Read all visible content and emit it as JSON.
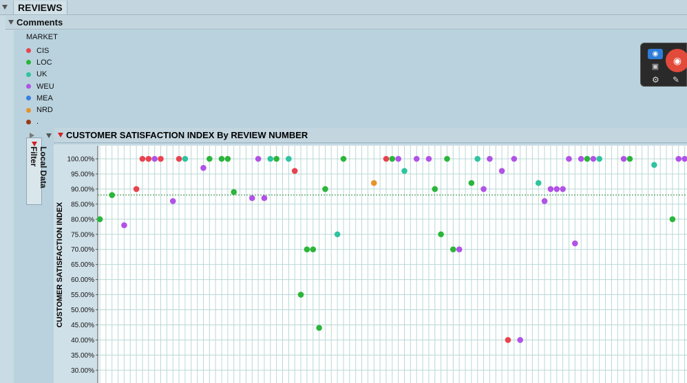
{
  "section": {
    "title": "REVIEWS"
  },
  "subsection": {
    "title": "Comments"
  },
  "legend": {
    "title": "MARKET",
    "items": [
      {
        "label": "CIS",
        "color": "#e8434f"
      },
      {
        "label": "LOC",
        "color": "#2ab53b"
      },
      {
        "label": "UK",
        "color": "#2fc3a0"
      },
      {
        "label": "WEU",
        "color": "#b053e6"
      },
      {
        "label": "MEA",
        "color": "#3a7ee0"
      },
      {
        "label": "NRD",
        "color": "#e8922a"
      },
      {
        "label": ".",
        "color": "#9a3a1a"
      }
    ]
  },
  "local_data_filter": {
    "label": "Local Data Filter"
  },
  "plot": {
    "title": "CUSTOMER SATISFACTION INDEX By REVIEW NUMBER"
  },
  "toolbar": {
    "icons": [
      "screenshot-icon",
      "video-icon",
      "record-icon",
      "settings-icon",
      "edit-icon"
    ]
  },
  "chart_data": {
    "type": "scatter",
    "title": "CUSTOMER SATISFACTION INDEX By REVIEW NUMBER",
    "ylabel": "CUSTOMER SATISFACTION INDEX",
    "xlabel": "",
    "ylim": [
      30,
      100
    ],
    "yticks": [
      "100.00%",
      "95.00%",
      "90.00%",
      "85.00%",
      "80.00%",
      "75.00%",
      "70.00%",
      "65.00%",
      "60.00%",
      "55.00%",
      "50.00%",
      "45.00%",
      "40.00%",
      "35.00%",
      "30.00%"
    ],
    "reference_line": 88,
    "grid": true,
    "legend_title": "MARKET",
    "points": [
      {
        "x": 1,
        "y": 80,
        "market": "LOC"
      },
      {
        "x": 3,
        "y": 88,
        "market": "LOC"
      },
      {
        "x": 5,
        "y": 78,
        "market": "WEU"
      },
      {
        "x": 7,
        "y": 90,
        "market": "CIS"
      },
      {
        "x": 8,
        "y": 100,
        "market": "CIS"
      },
      {
        "x": 9,
        "y": 100,
        "market": "CIS"
      },
      {
        "x": 10,
        "y": 100,
        "market": "WEU"
      },
      {
        "x": 11,
        "y": 100,
        "market": "CIS"
      },
      {
        "x": 13,
        "y": 86,
        "market": "WEU"
      },
      {
        "x": 14,
        "y": 100,
        "market": "CIS"
      },
      {
        "x": 15,
        "y": 100,
        "market": "UK"
      },
      {
        "x": 18,
        "y": 97,
        "market": "WEU"
      },
      {
        "x": 19,
        "y": 100,
        "market": "LOC"
      },
      {
        "x": 21,
        "y": 100,
        "market": "LOC"
      },
      {
        "x": 22,
        "y": 100,
        "market": "LOC"
      },
      {
        "x": 23,
        "y": 89,
        "market": "LOC"
      },
      {
        "x": 26,
        "y": 87,
        "market": "WEU"
      },
      {
        "x": 27,
        "y": 100,
        "market": "WEU"
      },
      {
        "x": 28,
        "y": 87,
        "market": "WEU"
      },
      {
        "x": 29,
        "y": 100,
        "market": "UK"
      },
      {
        "x": 30,
        "y": 100,
        "market": "LOC"
      },
      {
        "x": 32,
        "y": 100,
        "market": "UK"
      },
      {
        "x": 33,
        "y": 96,
        "market": "CIS"
      },
      {
        "x": 34,
        "y": 55,
        "market": "LOC"
      },
      {
        "x": 35,
        "y": 70,
        "market": "LOC"
      },
      {
        "x": 36,
        "y": 70,
        "market": "LOC"
      },
      {
        "x": 37,
        "y": 44,
        "market": "LOC"
      },
      {
        "x": 38,
        "y": 90,
        "market": "LOC"
      },
      {
        "x": 40,
        "y": 75,
        "market": "UK"
      },
      {
        "x": 41,
        "y": 100,
        "market": "LOC"
      },
      {
        "x": 46,
        "y": 92,
        "market": "NRD"
      },
      {
        "x": 48,
        "y": 100,
        "market": "CIS"
      },
      {
        "x": 49,
        "y": 100,
        "market": "LOC"
      },
      {
        "x": 50,
        "y": 100,
        "market": "WEU"
      },
      {
        "x": 51,
        "y": 96,
        "market": "UK"
      },
      {
        "x": 53,
        "y": 100,
        "market": "WEU"
      },
      {
        "x": 55,
        "y": 100,
        "market": "WEU"
      },
      {
        "x": 56,
        "y": 90,
        "market": "LOC"
      },
      {
        "x": 57,
        "y": 75,
        "market": "LOC"
      },
      {
        "x": 58,
        "y": 100,
        "market": "LOC"
      },
      {
        "x": 59,
        "y": 70,
        "market": "LOC"
      },
      {
        "x": 60,
        "y": 70,
        "market": "WEU"
      },
      {
        "x": 62,
        "y": 92,
        "market": "LOC"
      },
      {
        "x": 63,
        "y": 100,
        "market": "UK"
      },
      {
        "x": 64,
        "y": 90,
        "market": "WEU"
      },
      {
        "x": 65,
        "y": 100,
        "market": "WEU"
      },
      {
        "x": 67,
        "y": 96,
        "market": "WEU"
      },
      {
        "x": 68,
        "y": 40,
        "market": "CIS"
      },
      {
        "x": 69,
        "y": 100,
        "market": "WEU"
      },
      {
        "x": 70,
        "y": 40,
        "market": "WEU"
      },
      {
        "x": 73,
        "y": 92,
        "market": "UK"
      },
      {
        "x": 74,
        "y": 86,
        "market": "WEU"
      },
      {
        "x": 75,
        "y": 90,
        "market": "WEU"
      },
      {
        "x": 76,
        "y": 90,
        "market": "WEU"
      },
      {
        "x": 77,
        "y": 90,
        "market": "WEU"
      },
      {
        "x": 78,
        "y": 100,
        "market": "WEU"
      },
      {
        "x": 79,
        "y": 72,
        "market": "WEU"
      },
      {
        "x": 80,
        "y": 100,
        "market": "WEU"
      },
      {
        "x": 81,
        "y": 100,
        "market": "LOC"
      },
      {
        "x": 82,
        "y": 100,
        "market": "WEU"
      },
      {
        "x": 83,
        "y": 100,
        "market": "UK"
      },
      {
        "x": 87,
        "y": 100,
        "market": "WEU"
      },
      {
        "x": 88,
        "y": 100,
        "market": "LOC"
      },
      {
        "x": 92,
        "y": 98,
        "market": "UK"
      },
      {
        "x": 95,
        "y": 80,
        "market": "LOC"
      },
      {
        "x": 96,
        "y": 100,
        "market": "WEU"
      },
      {
        "x": 97,
        "y": 100,
        "market": "WEU"
      }
    ]
  }
}
